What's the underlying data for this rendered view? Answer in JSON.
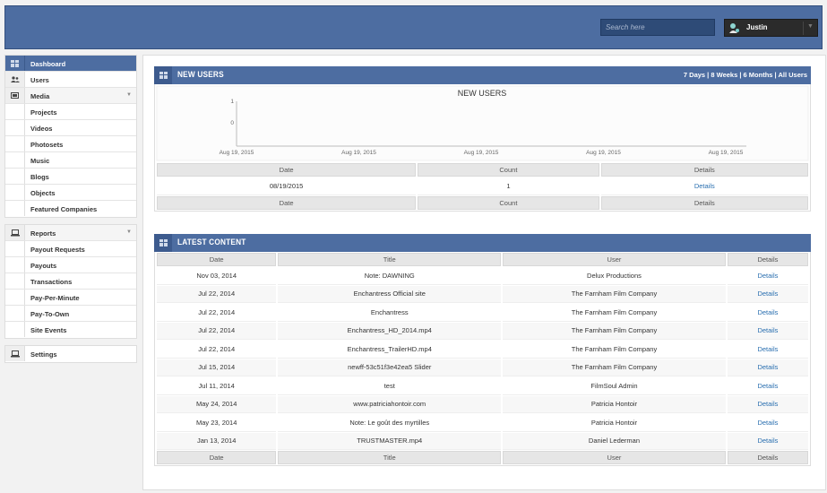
{
  "header": {
    "search_placeholder": "Search here",
    "user_name": "Justin"
  },
  "sidebar": {
    "dashboard": "Dashboard",
    "users": "Users",
    "media": "Media",
    "media_items": [
      "Projects",
      "Videos",
      "Photosets",
      "Music",
      "Blogs",
      "Objects",
      "Featured Companies"
    ],
    "reports": "Reports",
    "report_items": [
      "Payout Requests",
      "Payouts",
      "Transactions",
      "Pay-Per-Minute",
      "Pay-To-Own",
      "Site Events"
    ],
    "settings": "Settings"
  },
  "new_users": {
    "title": "NEW USERS",
    "ranges": [
      "7 Days",
      "8 Weeks",
      "6 Months",
      "All Users"
    ],
    "range_sep": " | ",
    "chart_data": {
      "type": "line",
      "title": "NEW USERS",
      "x_tick_labels": [
        "Aug 19, 2015",
        "Aug 19, 2015",
        "Aug 19, 2015",
        "Aug 19, 2015",
        "Aug 19, 2015"
      ],
      "y_tick_labels": [
        "1",
        "0"
      ],
      "series": [
        {
          "values": []
        }
      ]
    },
    "columns": [
      "Date",
      "Count",
      "Details"
    ],
    "rows": [
      [
        "08/19/2015",
        "1",
        "Details"
      ]
    ]
  },
  "latest_content": {
    "title": "LATEST CONTENT",
    "columns": [
      "Date",
      "Title",
      "User",
      "Details"
    ],
    "rows": [
      [
        "Nov 03, 2014",
        "Note: DAWNING",
        "Delux Productions",
        "Details"
      ],
      [
        "Jul 22, 2014",
        "Enchantress Official site",
        "The Farnham Film Company",
        "Details"
      ],
      [
        "Jul 22, 2014",
        "Enchantress",
        "The Farnham Film Company",
        "Details"
      ],
      [
        "Jul 22, 2014",
        "Enchantress_HD_2014.mp4",
        "The Farnham Film Company",
        "Details"
      ],
      [
        "Jul 22, 2014",
        "Enchantress_TrailerHD.mp4",
        "The Farnham Film Company",
        "Details"
      ],
      [
        "Jul 15, 2014",
        "newff-53c51f3e42ea5 Slider",
        "The Farnham Film Company",
        "Details"
      ],
      [
        "Jul 11, 2014",
        "test",
        "FilmSoul Admin",
        "Details"
      ],
      [
        "May 24, 2014",
        "www.patriciahontoir.com",
        "Patricia Hontoir",
        "Details"
      ],
      [
        "May 23, 2014",
        "Note: Le goût des myrtilles",
        "Patricia Hontoir",
        "Details"
      ],
      [
        "Jan 13, 2014",
        "TRUSTMASTER.mp4",
        "Daniel Lederman",
        "Details"
      ]
    ]
  }
}
